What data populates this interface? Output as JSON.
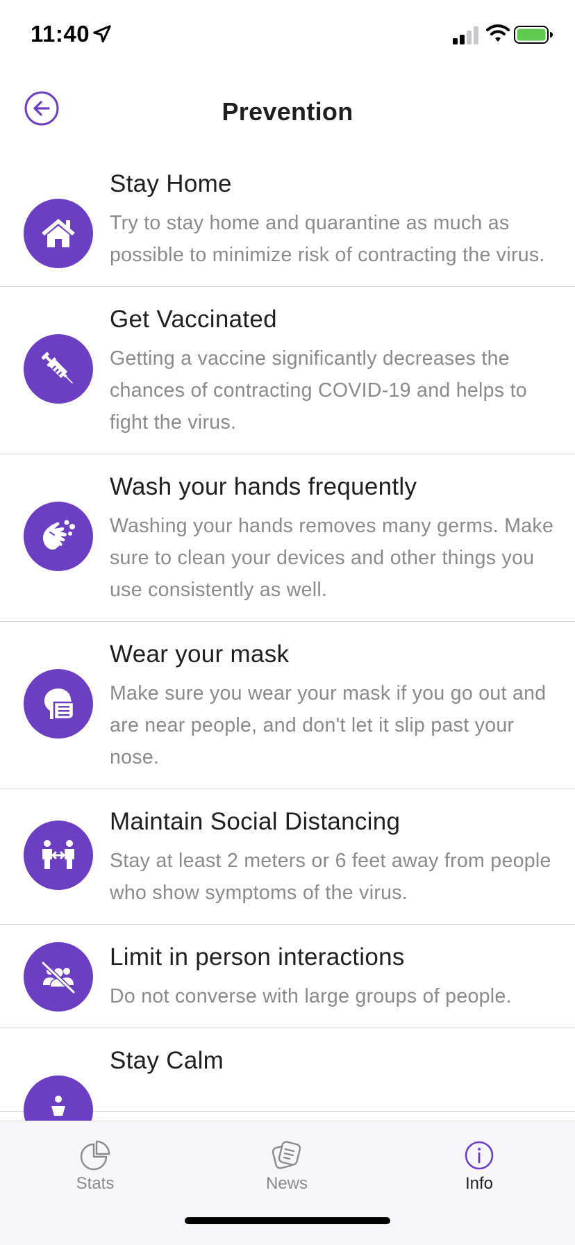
{
  "status": {
    "time": "11:40"
  },
  "header": {
    "title": "Prevention",
    "back_icon": "arrow-left-circle-icon"
  },
  "colors": {
    "accent": "#6c3fc2",
    "battery": "#5ecb4f",
    "divider": "#cfcfd3",
    "muted": "#8a8a8e"
  },
  "items": [
    {
      "title": "Stay Home",
      "desc": "Try to stay home and quarantine as much as possible to minimize risk of contracting the virus.",
      "icon": "house-icon"
    },
    {
      "title": "Get Vaccinated",
      "desc": "Getting a vaccine significantly decreases the chances of contracting COVID-19 and helps to fight the virus.",
      "icon": "syringe-icon"
    },
    {
      "title": "Wash your hands frequently",
      "desc": "Washing your hands removes many germs. Make sure to clean your devices and other things you use consistently as well.",
      "icon": "hands-wash-icon"
    },
    {
      "title": "Wear your mask",
      "desc": "Make sure you wear your mask if you go out and are near people, and don't let it slip past your nose.",
      "icon": "head-mask-icon"
    },
    {
      "title": "Maintain Social Distancing",
      "desc": "Stay at least 2 meters or 6 feet away from people who show symptoms of the virus.",
      "icon": "people-distance-icon"
    },
    {
      "title": "Limit in person interactions",
      "desc": "Do not converse with large groups of people.",
      "icon": "users-slash-icon"
    },
    {
      "title": "Stay Calm",
      "desc": "",
      "icon": "calm-icon"
    }
  ],
  "tabs": [
    {
      "label": "Stats",
      "icon": "pie-chart-icon",
      "active": false
    },
    {
      "label": "News",
      "icon": "news-icon",
      "active": false
    },
    {
      "label": "Info",
      "icon": "info-circle-icon",
      "active": true
    }
  ]
}
